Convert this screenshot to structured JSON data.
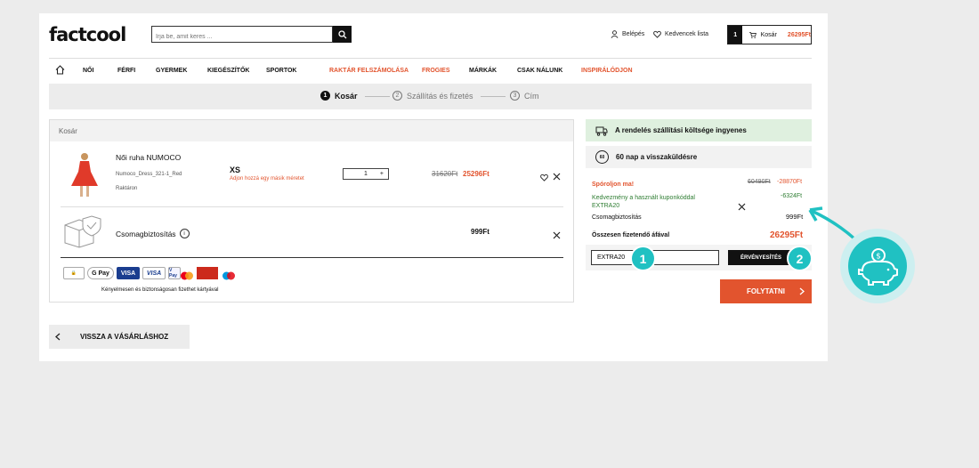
{
  "header": {
    "logo": "factcool",
    "search_placeholder": "Írja be, amit keres ...",
    "login_label": "Belépés",
    "favorites_label": "Kedvencek lista",
    "cart_count": "1",
    "cart_label": "Kosár",
    "cart_total": "26295Ft"
  },
  "nav": {
    "items": [
      "NŐI",
      "FÉRFI",
      "GYERMEK",
      "KIEGÉSZÍTŐK",
      "SPORTOK",
      "RAKTÁR FELSZÁMOLÁSA",
      "FROGIES",
      "MÁRKÁK",
      "CSAK NÁLUNK",
      "INSPIRÁLÓDJON"
    ]
  },
  "steps": [
    {
      "num": "1",
      "label": "Kosár"
    },
    {
      "num": "2",
      "label": "Szállítás és fizetés"
    },
    {
      "num": "3",
      "label": "Cím"
    }
  ],
  "cart": {
    "title": "Kosár",
    "product": {
      "name": "Női ruha NUMOCO",
      "sku": "Numoco_Dress_321-1_Red",
      "stock": "Raktáron",
      "size": "XS",
      "size_note": "Adjon hozzá egy másik méretet",
      "qty": "1",
      "old_price": "31620Ft",
      "price": "25296Ft"
    },
    "insurance": {
      "label": "Csomagbiztosítás",
      "price": "999Ft"
    },
    "payment_note": "Kényelmesen és biztonságosan fizethet kártyával",
    "payment_methods": [
      "G Pay",
      "VISA",
      "VISA",
      "V Pay"
    ]
  },
  "summary": {
    "free_shipping": "A rendelés szállítási költsége ingyenes",
    "return_days": "60 nap a visszaküldésre",
    "savings_label": "Spóroljon ma!",
    "savings_old": "60490Ft",
    "savings_value": "-28870Ft",
    "coupon_label": "Kedvezmény a használt kuponkóddal",
    "coupon_code": "EXTRA20",
    "coupon_value": "-6324Ft",
    "insurance_label": "Csomagbiztosítás",
    "insurance_value": "999Ft",
    "total_label": "Összesen fizetendő áfával",
    "total_value": "26295Ft",
    "coupon_input_value": "EXTRA20",
    "apply_label": "ÉRVÉNYESÍTÉS",
    "continue_label": "FOLYTATNI"
  },
  "back_label": "VISSZA A VÁSÁRLÁSHOZ",
  "annotations": {
    "badge1": "1",
    "badge2": "2"
  },
  "colors": {
    "accent": "#e2542e",
    "teal": "#20c1c2",
    "green": "#2e7d32"
  }
}
